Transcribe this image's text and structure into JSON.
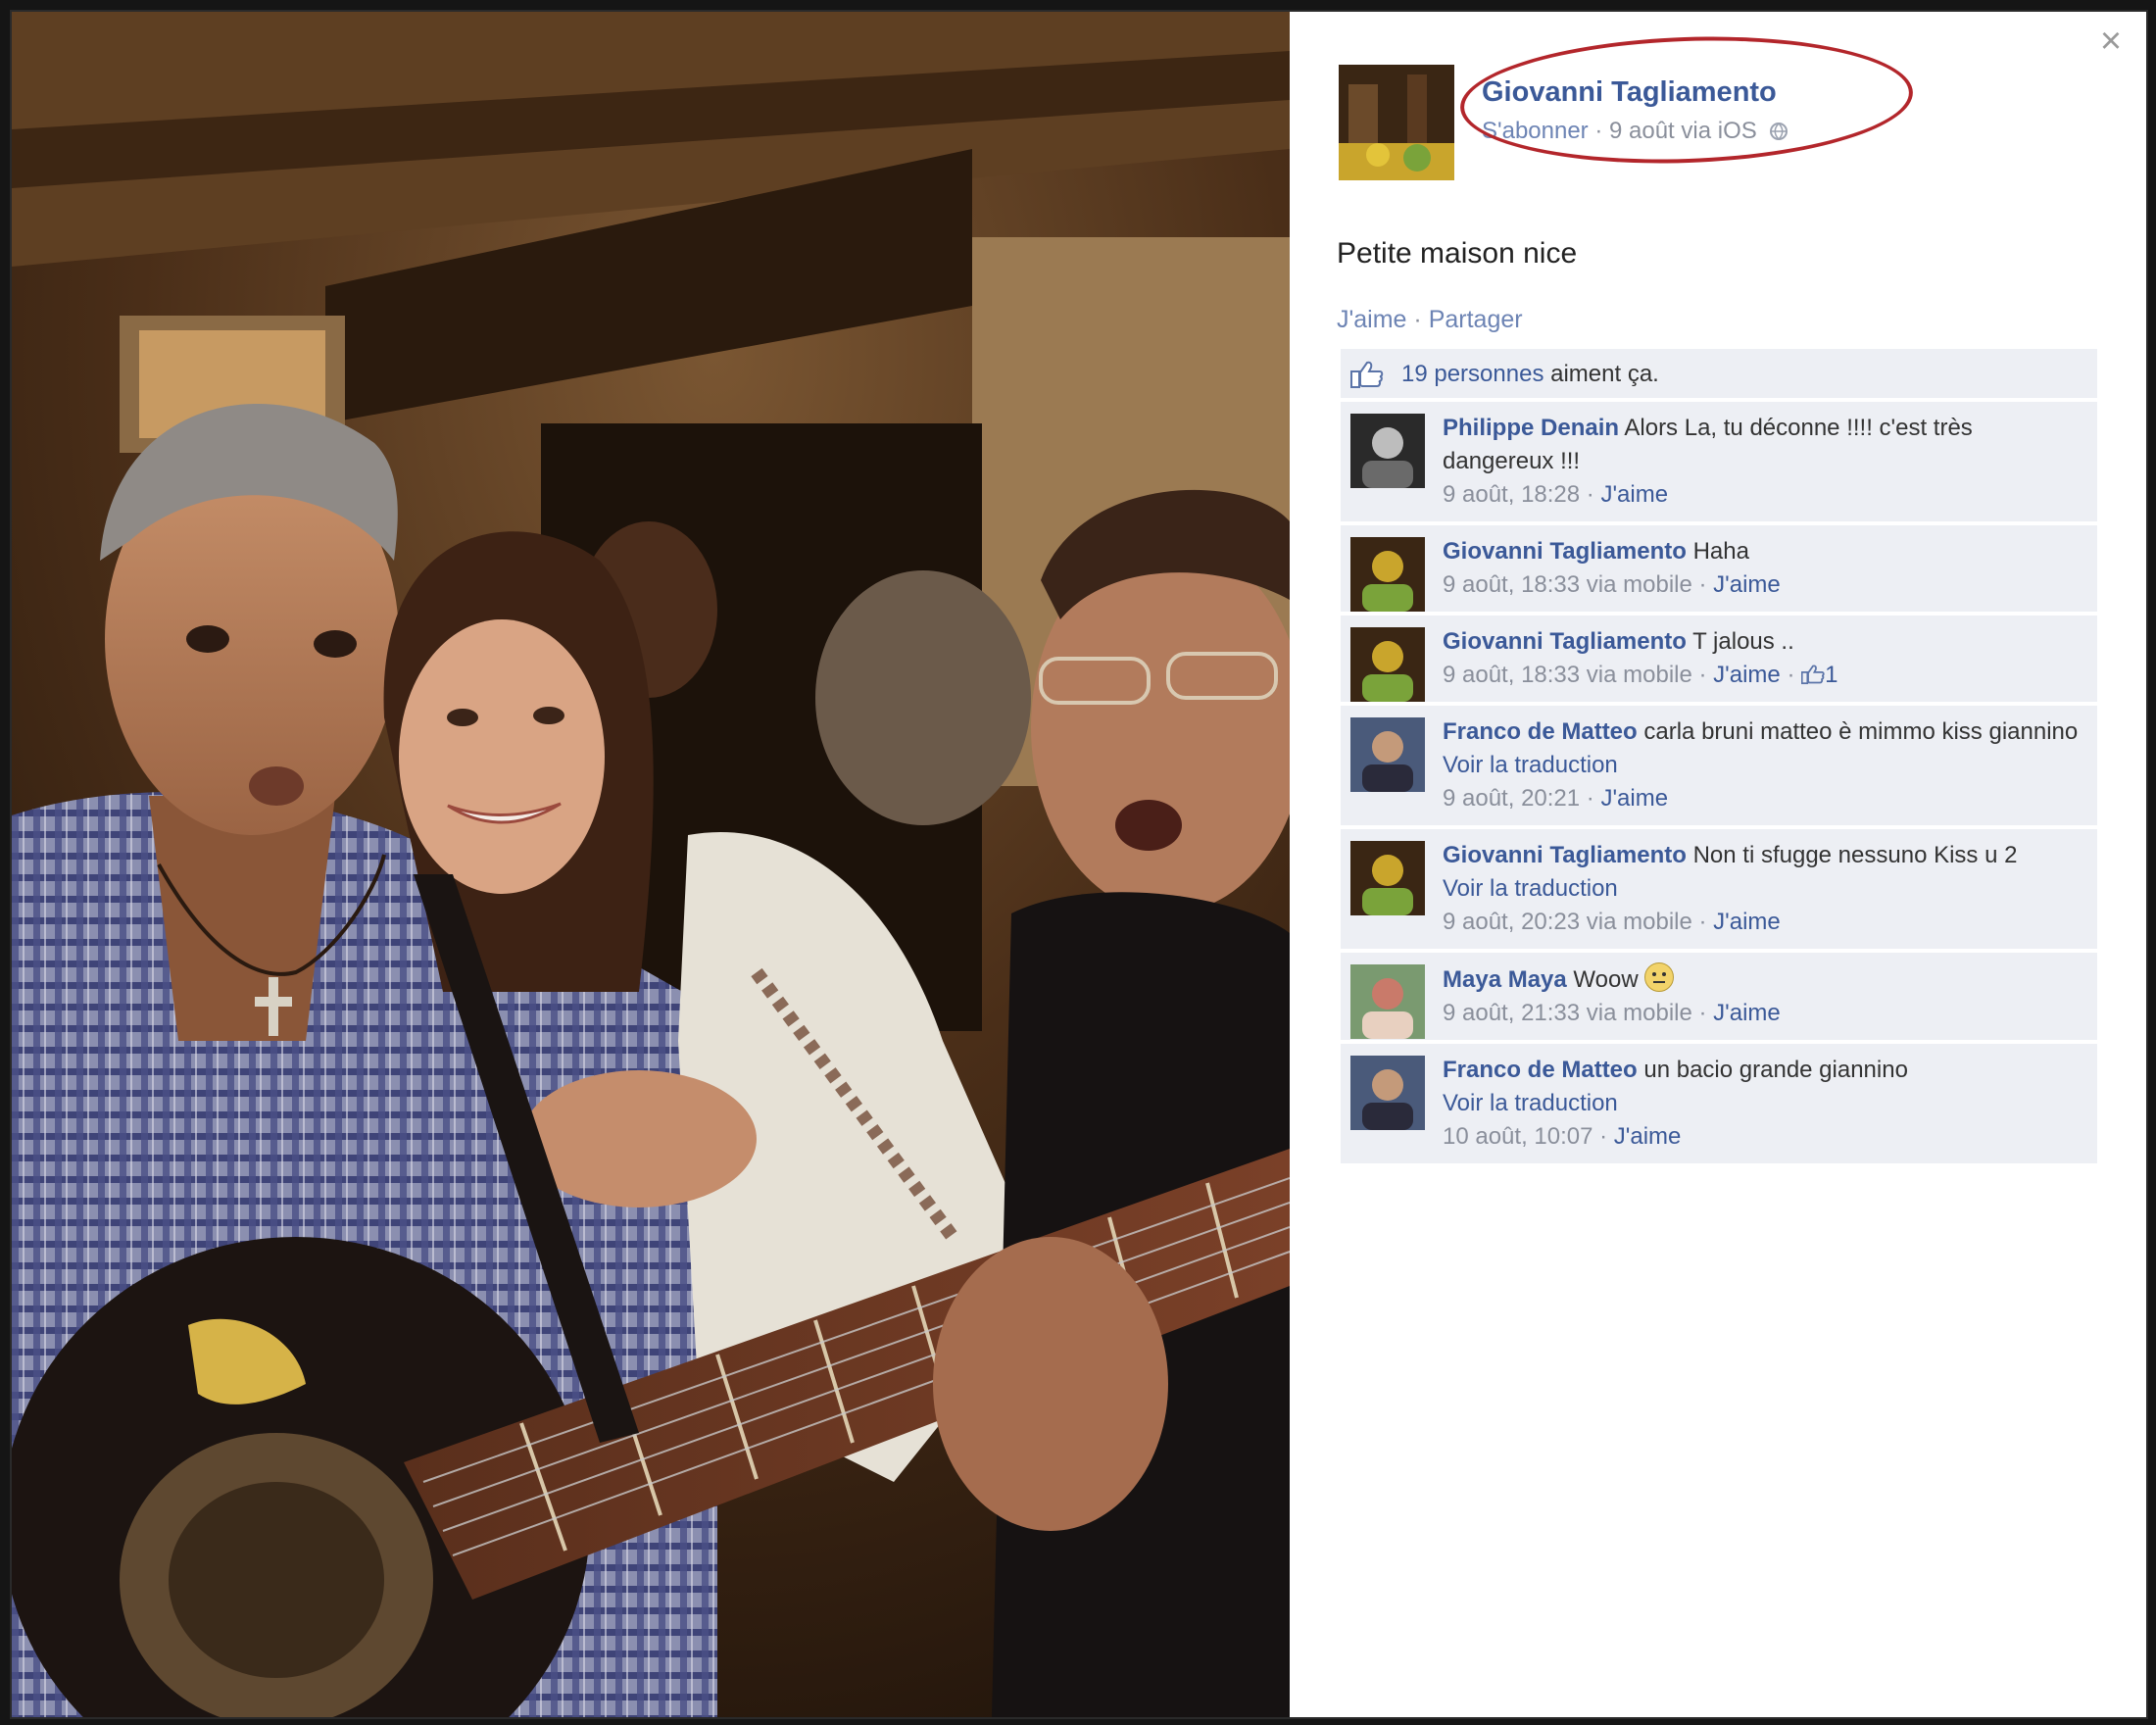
{
  "window": {
    "close_label": "×"
  },
  "post": {
    "author_name": "Giovanni Tagliamento",
    "subscribe_label": "S'abonner",
    "separator": " · ",
    "date_via": "9 août via iOS",
    "caption": "Petite maison nice",
    "like_label": "J'aime",
    "share_label": "Partager",
    "likes_count_link": "19 personnes",
    "likes_suffix": " aiment ça."
  },
  "comments": [
    {
      "author": "Philippe Denain",
      "text": "Alors La, tu déconne !!!! c'est très dangereux !!!",
      "time": "9 août, 18:28",
      "via": "",
      "like_label": "J'aime",
      "likes": "",
      "translate": ""
    },
    {
      "author": "Giovanni Tagliamento",
      "text": "Haha",
      "time": "9 août, 18:33",
      "via": " via mobile",
      "like_label": "J'aime",
      "likes": "",
      "translate": ""
    },
    {
      "author": "Giovanni Tagliamento",
      "text": "T jalous ..",
      "time": "9 août, 18:33",
      "via": " via mobile",
      "like_label": "J'aime",
      "likes": "1",
      "translate": ""
    },
    {
      "author": "Franco de Matteo",
      "text": "carla bruni matteo è mimmo kiss giannino",
      "time": "9 août, 20:21",
      "via": "",
      "like_label": "J'aime",
      "likes": "",
      "translate": "Voir la traduction"
    },
    {
      "author": "Giovanni Tagliamento",
      "text": "Non ti sfugge nessuno Kiss u 2",
      "time": "9 août, 20:23",
      "via": " via mobile",
      "like_label": "J'aime",
      "likes": "",
      "translate": "Voir la traduction"
    },
    {
      "author": "Maya Maya",
      "text": "Woow",
      "time": "9 août, 21:33",
      "via": " via mobile",
      "like_label": "J'aime",
      "likes": "",
      "translate": "",
      "emoji": "smiley-icon"
    },
    {
      "author": "Franco de Matteo",
      "text": "un bacio grande giannino",
      "time": "10 août, 10:07",
      "via": "",
      "like_label": "J'aime",
      "likes": "",
      "translate": "Voir la traduction"
    }
  ],
  "colors": {
    "link": "#3b5998",
    "comment_bg": "#edeff4",
    "highlight": "#b3262b"
  }
}
